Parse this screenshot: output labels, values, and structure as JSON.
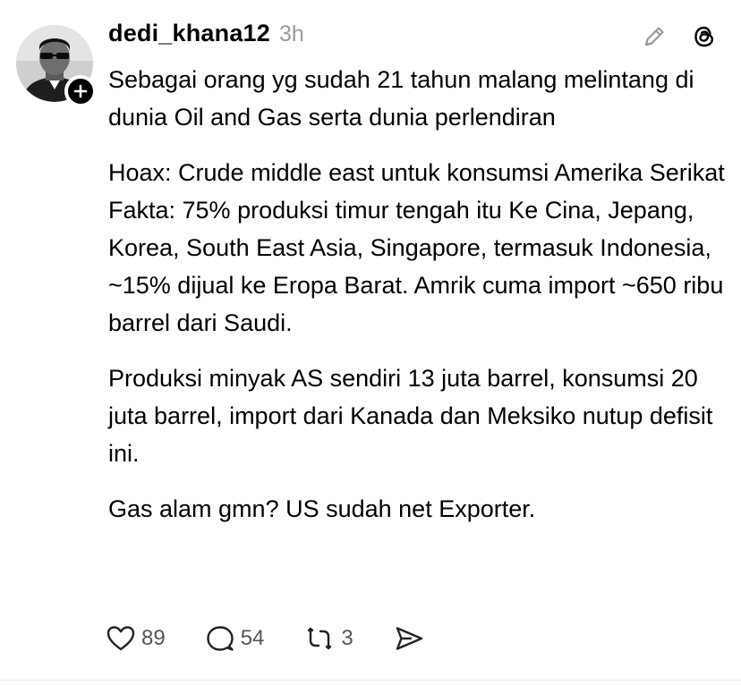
{
  "post": {
    "author": {
      "username": "dedi_khana12",
      "avatar_icon": "profile-photo",
      "follow_icon": "plus-icon"
    },
    "timestamp": "3h",
    "top_actions": [
      {
        "name": "edit-icon"
      },
      {
        "name": "threads-logo-icon"
      }
    ],
    "paragraphs": [
      "Sebagai orang yg sudah 21 tahun malang melintang di dunia Oil and Gas serta dunia perlendiran",
      "Hoax: Crude middle east untuk konsumsi Amerika Serikat",
      "Fakta: 75% produksi timur tengah itu Ke Cina, Jepang, Korea, South East Asia, Singapore, termasuk Indonesia, ~15% dijual ke Eropa Barat. Amrik cuma import ~650 ribu barrel dari Saudi.",
      "Produksi minyak AS sendiri 13 juta barrel, konsumsi 20 juta barrel, import dari Kanada dan Meksiko nutup defisit ini.",
      "Gas alam gmn? US sudah net Exporter."
    ],
    "stats": {
      "likes": "89",
      "replies": "54",
      "reposts": "3"
    }
  },
  "colors": {
    "text": "#000000",
    "muted": "#9a9a9a",
    "icon": "#222222"
  }
}
